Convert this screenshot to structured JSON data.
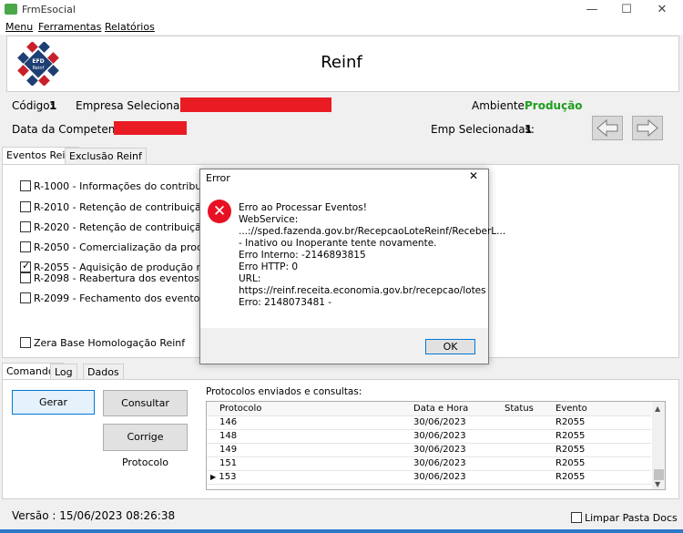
{
  "window": {
    "title": "FrmEsocial",
    "minimize": "—",
    "maximize": "☐",
    "close": "✕"
  },
  "menu": [
    "Menu",
    "Ferramentas",
    "Relatórios"
  ],
  "header": {
    "title": "Reinf",
    "logo_text": "EFD\nReinf"
  },
  "info": {
    "codigo_label": "Código:",
    "codigo_value": "1",
    "empresa_label": "Empresa Selecionada:",
    "ambiente_label": "Ambiente:",
    "ambiente_value": "Produção",
    "data_label": "Data da Competencia:",
    "emp_sel_label": "Emp Selecionadas:",
    "emp_sel_value": "1"
  },
  "colors": {
    "redact": "#e91c24",
    "producao": "#1e9e1e",
    "error": "#e81123"
  },
  "top_tabs": [
    "Eventos Reinf",
    "Exclusão Reinf"
  ],
  "events": [
    {
      "label": "R-1000 - Informações do contribuinte",
      "checked": false
    },
    {
      "label": "R-2010 - Retenção de contribuição previder",
      "checked": false
    },
    {
      "label": "R-2020 - Retenção de contribuição previder",
      "checked": false
    },
    {
      "label": "R-2050 - Comercialização da produção por p",
      "checked": false
    },
    {
      "label": "R-2055 - Aquisição de produção rural",
      "checked": true
    },
    {
      "label": "R-2098 - Reabertura dos eventos periódicos",
      "checked": false
    },
    {
      "label": "R-2099 - Fechamento dos eventos periódicos",
      "checked": false
    }
  ],
  "zera_label": "Zera Base Homologação Reinf",
  "bottom_tabs": [
    "Comandos",
    "Log",
    "Dados"
  ],
  "buttons": {
    "gerar": "Gerar",
    "consultar": "Consultar",
    "corrige": "Corrige Protocolo"
  },
  "protocolos": {
    "title": "Protocolos enviados e consultas:",
    "columns": [
      "Protocolo",
      "Data e Hora",
      "Status",
      "Evento"
    ],
    "rows": [
      [
        "146",
        "30/06/2023",
        "",
        "R2055"
      ],
      [
        "148",
        "30/06/2023",
        "",
        "R2055"
      ],
      [
        "149",
        "30/06/2023",
        "",
        "R2055"
      ],
      [
        "151",
        "30/06/2023",
        "",
        "R2055"
      ],
      [
        "153",
        "30/06/2023",
        "",
        "R2055"
      ]
    ]
  },
  "versao": "Versão :  15/06/2023 08:26:38",
  "limpar_label": "Limpar Pasta Docs",
  "dialog": {
    "title": "Error",
    "lines": [
      "Erro ao Processar Eventos!",
      "WebService:",
      "...://sped.fazenda.gov.br/RecepcaoLoteReinf/ReceberL...",
      "- Inativo ou Inoperante tente novamente.",
      "Erro Interno: -2146893815",
      "Erro HTTP: 0",
      "URL:",
      "https://reinf.receita.economia.gov.br/recepcao/lotes",
      "Erro: 2148073481 -"
    ],
    "ok": "OK"
  }
}
